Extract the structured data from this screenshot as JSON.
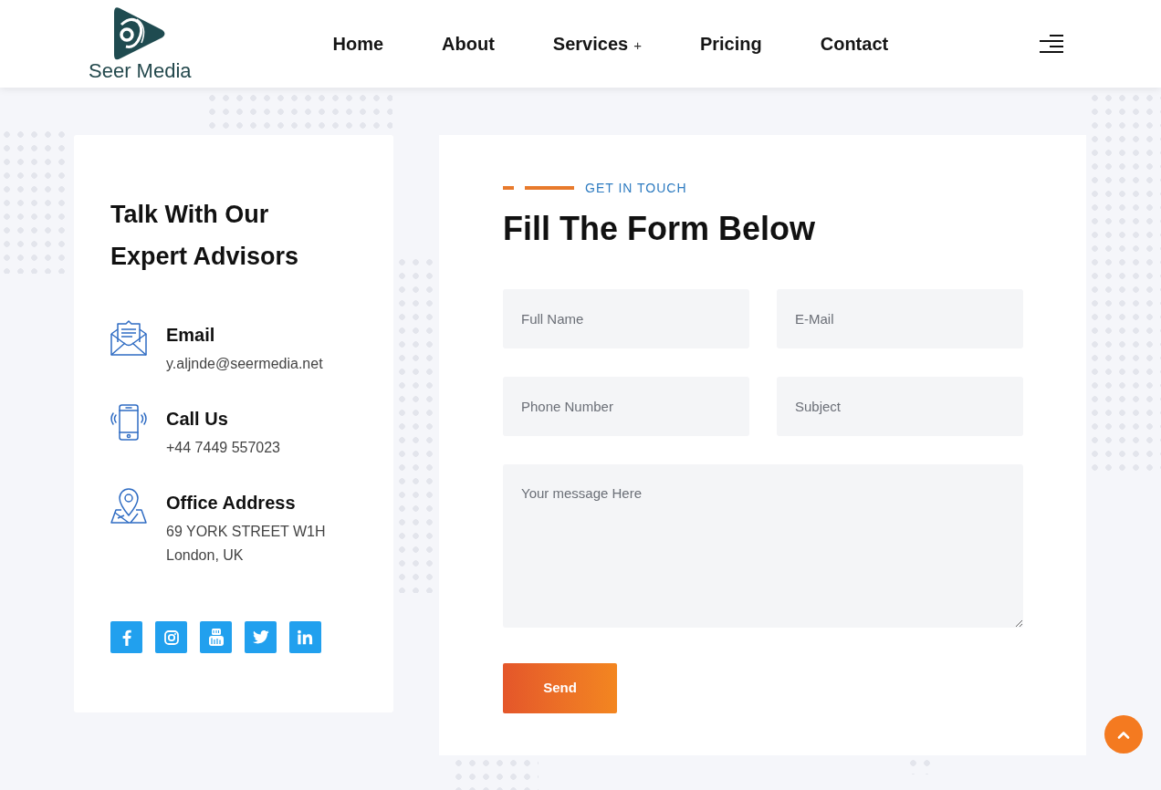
{
  "header": {
    "logo": {
      "text": "Seer Media"
    },
    "nav": [
      {
        "label": "Home"
      },
      {
        "label": "About"
      },
      {
        "label": "Services",
        "expander": "+"
      },
      {
        "label": "Pricing"
      },
      {
        "label": "Contact"
      }
    ]
  },
  "contact_panel": {
    "title": "Talk With Our Expert Advisors",
    "items": [
      {
        "kind": "email",
        "label": "Email",
        "lines": [
          "y.aljnde@seermedia.net"
        ]
      },
      {
        "kind": "phone",
        "label": "Call Us",
        "lines": [
          "+44 7449 557023"
        ]
      },
      {
        "kind": "address",
        "label": "Office Address",
        "lines": [
          "69 YORK STREET W1H",
          "London, UK"
        ]
      }
    ],
    "social": [
      {
        "kind": "facebook"
      },
      {
        "kind": "instagram"
      },
      {
        "kind": "youtube"
      },
      {
        "kind": "twitter"
      },
      {
        "kind": "linkedin"
      }
    ]
  },
  "form": {
    "eyebrow": "GET IN TOUCH",
    "title": "Fill The Form Below",
    "fields": [
      {
        "kind": "input",
        "placeholder": "Full Name"
      },
      {
        "kind": "input",
        "placeholder": "E-Mail"
      },
      {
        "kind": "input",
        "placeholder": "Phone Number"
      },
      {
        "kind": "input",
        "placeholder": "Subject"
      },
      {
        "kind": "textarea",
        "placeholder": "Your message Here"
      }
    ],
    "submit": "Send"
  }
}
